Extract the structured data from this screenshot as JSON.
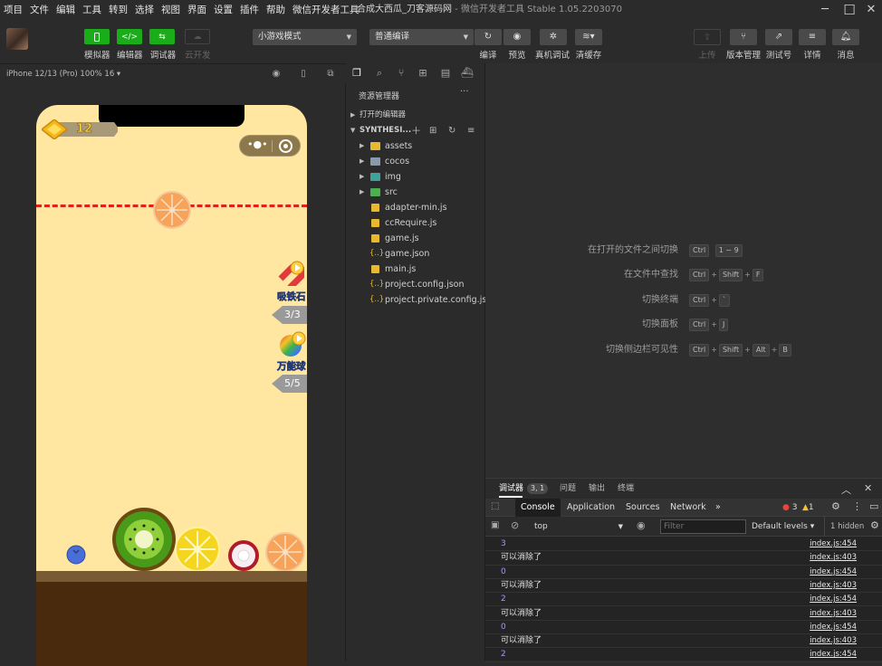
{
  "menubar": {
    "items": [
      "项目",
      "文件",
      "编辑",
      "工具",
      "转到",
      "选择",
      "视图",
      "界面",
      "设置",
      "插件",
      "帮助",
      "微信开发者工具"
    ],
    "title_main": "合成大西瓜_刀客源码网",
    "title_suffix": " - 微信开发者工具 Stable 1.05.2203070"
  },
  "toolbar": {
    "simulator": "模拟器",
    "editor": "编辑器",
    "debugger": "调试器",
    "cloud": "云开发",
    "mode_select": "小游戏模式",
    "compile_select": "普通编译",
    "compile": "编译",
    "preview": "预览",
    "remote_debug": "真机调试",
    "clear_cache": "清缓存",
    "upload": "上传",
    "version": "版本管理",
    "test_account": "测试号",
    "details": "详情",
    "messages": "消息"
  },
  "simulator": {
    "device": "iPhone 12/13 (Pro) 100% 16 ▾",
    "game": {
      "score": "12",
      "powerups": [
        {
          "label": "吸铁石",
          "count": "3/3",
          "icon": "magnet-icon"
        },
        {
          "label": "万能球",
          "count": "5/5",
          "icon": "rainbow-ball-icon"
        }
      ]
    }
  },
  "explorer": {
    "title": "资源管理器",
    "more": "···",
    "open_editors": "打开的编辑器",
    "project": "SYNTHESI...",
    "tree": [
      {
        "name": "assets",
        "type": "folder",
        "color": "#e8b830"
      },
      {
        "name": "cocos",
        "type": "folder",
        "color": "#8a9aaa"
      },
      {
        "name": "img",
        "type": "folder",
        "color": "#3fa39a"
      },
      {
        "name": "src",
        "type": "folder",
        "color": "#4caf50"
      },
      {
        "name": "adapter-min.js",
        "type": "js"
      },
      {
        "name": "ccRequire.js",
        "type": "js"
      },
      {
        "name": "game.js",
        "type": "js"
      },
      {
        "name": "game.json",
        "type": "json"
      },
      {
        "name": "main.js",
        "type": "js"
      },
      {
        "name": "project.config.json",
        "type": "json"
      },
      {
        "name": "project.private.config.js...",
        "type": "json"
      }
    ]
  },
  "shortcuts": [
    {
      "label": "在打开的文件之间切换",
      "keys": [
        "Ctrl",
        "1 ~ 9"
      ]
    },
    {
      "label": "在文件中查找",
      "keys": [
        "Ctrl",
        "Shift",
        "F"
      ]
    },
    {
      "label": "切换终端",
      "keys": [
        "Ctrl",
        "`"
      ]
    },
    {
      "label": "切换面板",
      "keys": [
        "Ctrl",
        "J"
      ]
    },
    {
      "label": "切换侧边栏可见性",
      "keys": [
        "Ctrl",
        "Shift",
        "Alt",
        "B"
      ]
    }
  ],
  "devtools": {
    "tab_debugger": "调试器",
    "debugger_badge": "3, 1",
    "tab_problems": "问题",
    "tab_output": "输出",
    "tab_terminal": "终端",
    "tabs": [
      "Console",
      "Application",
      "Sources",
      "Network"
    ],
    "more": "»",
    "errors": "3",
    "warnings": "1",
    "context": "top",
    "filter_placeholder": "Filter",
    "levels": "Default levels ▾",
    "hidden": "1 hidden",
    "logs": [
      {
        "msg": "3",
        "src": "index.js:454",
        "kind": "num"
      },
      {
        "msg": "可以消除了",
        "src": "index.js:403",
        "kind": "txt"
      },
      {
        "msg": "0",
        "src": "index.js:454",
        "kind": "num"
      },
      {
        "msg": "可以消除了",
        "src": "index.js:403",
        "kind": "txt"
      },
      {
        "msg": "2",
        "src": "index.js:454",
        "kind": "num"
      },
      {
        "msg": "可以消除了",
        "src": "index.js:403",
        "kind": "txt"
      },
      {
        "msg": "0",
        "src": "index.js:454",
        "kind": "num"
      },
      {
        "msg": "可以消除了",
        "src": "index.js:403",
        "kind": "txt"
      },
      {
        "msg": "2",
        "src": "index.js:454",
        "kind": "num"
      }
    ]
  }
}
